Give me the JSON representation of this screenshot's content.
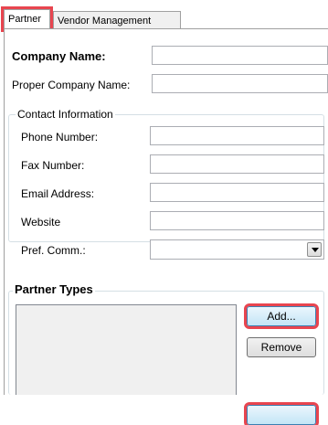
{
  "tabs": [
    {
      "label": "Partner"
    },
    {
      "label": "Vendor Management"
    }
  ],
  "company": {
    "company_name_label": "Company Name:",
    "company_name_value": "",
    "proper_name_label": "Proper Company Name:",
    "proper_name_value": ""
  },
  "contact": {
    "title": "Contact Information",
    "phone_label": "Phone Number:",
    "phone_value": "",
    "fax_label": "Fax Number:",
    "fax_value": "",
    "email_label": "Email Address:",
    "email_value": "",
    "website_label": "Website",
    "website_value": "",
    "pref_comm_label": "Pref. Comm.:",
    "pref_comm_value": ""
  },
  "partner_types": {
    "title": "Partner Types",
    "add_label": "Add...",
    "remove_label": "Remove"
  },
  "colors": {
    "highlight": "#e8454f",
    "focus_border": "#3c7fb1"
  }
}
